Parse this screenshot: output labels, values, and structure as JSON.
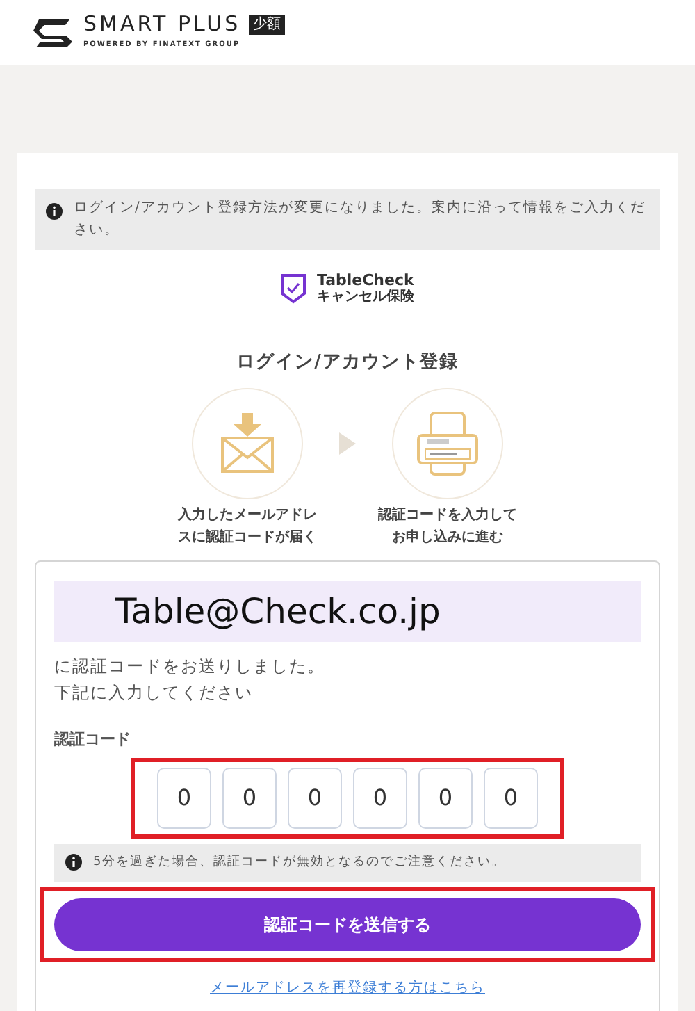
{
  "header": {
    "brand": "SMART PLUS",
    "badge": "少額",
    "tagline": "POWERED BY FINATEXT GROUP"
  },
  "notice": "ログイン/アカウント登録方法が変更になりました。案内に沿って情報をご入力ください。",
  "partner": {
    "name": "TableCheck",
    "product": "キャンセル保険"
  },
  "title": "ログイン/アカウント登録",
  "steps": [
    {
      "kind": "mail",
      "lines": [
        "入力したメールアドレ",
        "スに認証コードが届く"
      ]
    },
    {
      "kind": "phone",
      "lines": [
        "認証コードを入力して",
        "お申し込みに進む"
      ]
    }
  ],
  "form": {
    "email": "Table@Check.co.jp",
    "message_lines": [
      "に認証コードをお送りしました。",
      "下記に入力してください"
    ],
    "code_label": "認証コード",
    "code_digits": [
      "0",
      "0",
      "0",
      "0",
      "0",
      "0"
    ],
    "expiry_note": "5分を過ぎた場合、認証コードが無効となるのでご注意ください。",
    "submit": "認証コードを送信する",
    "reregister_link": "メールアドレスを再登録する方はこちら"
  }
}
